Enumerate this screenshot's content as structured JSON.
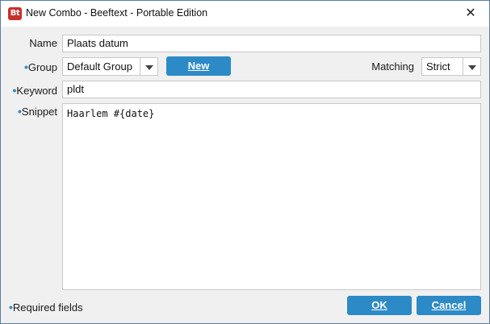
{
  "window": {
    "title": "New Combo - Beeftext - Portable Edition",
    "app_icon_text": "Bt",
    "close_glyph": "✕"
  },
  "form": {
    "name_label": "Name",
    "name_value": "Plaats datum",
    "required_marker": "•",
    "group_label": "Group",
    "group_value": "Default Group",
    "new_button": "New",
    "matching_label": "Matching",
    "matching_value": "Strict",
    "keyword_label": "Keyword",
    "keyword_value": "pldt",
    "snippet_label": "Snippet",
    "snippet_value": "Haarlem #{date}"
  },
  "footer": {
    "required_fields": "Required fields",
    "ok_button": "OK",
    "cancel_button": "Cancel"
  },
  "icons": {
    "app": "beeftext-logo-icon",
    "close": "close-icon",
    "dropdown": "chevron-down-icon"
  },
  "colors": {
    "accent": "#2c8ac6",
    "required_marker": "#2f8ac7",
    "app_icon": "#c9302c"
  }
}
